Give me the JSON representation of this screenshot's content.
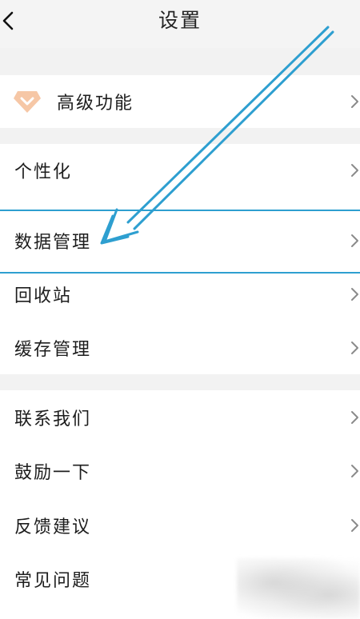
{
  "header": {
    "title": "设置",
    "back_icon": "chevron-left-icon"
  },
  "groups": [
    {
      "items": [
        {
          "label": "高级功能",
          "icon": "diamond-icon",
          "icon_color": "#f3b68f"
        }
      ]
    },
    {
      "items": [
        {
          "label": "个性化"
        },
        {
          "label": "数据管理",
          "highlighted": true
        },
        {
          "label": "回收站"
        },
        {
          "label": "缓存管理"
        }
      ]
    },
    {
      "items": [
        {
          "label": "联系我们"
        },
        {
          "label": "鼓励一下"
        },
        {
          "label": "反馈建议"
        },
        {
          "label": "常见问题"
        }
      ]
    }
  ],
  "annotation": {
    "highlight_color": "#2e9fd0",
    "arrow_icon": "annotation-arrow-icon"
  },
  "chevron_icon": "chevron-right-icon"
}
